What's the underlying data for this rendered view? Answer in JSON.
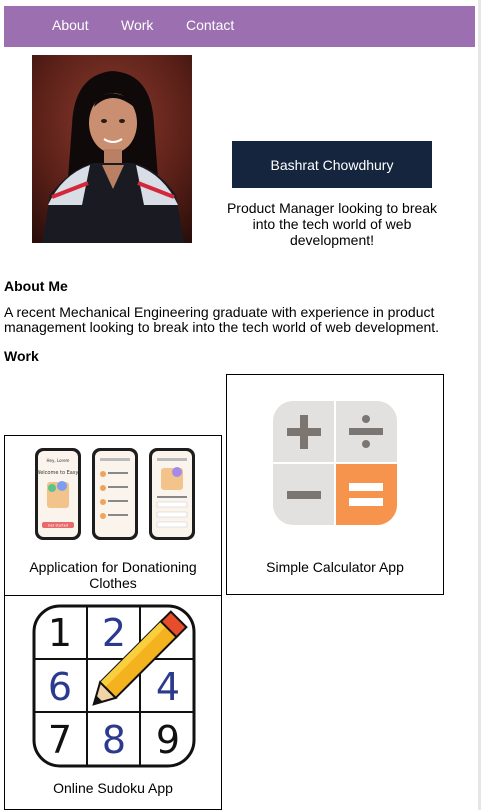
{
  "nav": {
    "items": [
      "About",
      "Work",
      "Contact"
    ],
    "color": "#9b6fb0"
  },
  "profile": {
    "name": "Bashrat Chowdhury",
    "tagline": "Product Manager looking to break into the tech world of web development!",
    "name_box_color": "#14253d"
  },
  "about": {
    "heading": "About Me",
    "text": "A recent Mechanical Engineering graduate with experience in product management looking to break into the tech world of web development."
  },
  "work": {
    "heading": "Work",
    "projects": [
      {
        "title": "Application for Donationing Clothes",
        "image": "phone-mockups-image"
      },
      {
        "title": "Simple Calculator App",
        "image": "calculator-icon"
      },
      {
        "title": "Online Sudoku App",
        "image": "sudoku-pencil-icon"
      }
    ]
  },
  "sudoku_digits": [
    "1",
    "2",
    "6",
    "4",
    "7",
    "8",
    "9"
  ],
  "phone_screens": {
    "screen1": "Welcome to Easy!",
    "header1": "Hey, Lorem",
    "button1": "Get started"
  }
}
